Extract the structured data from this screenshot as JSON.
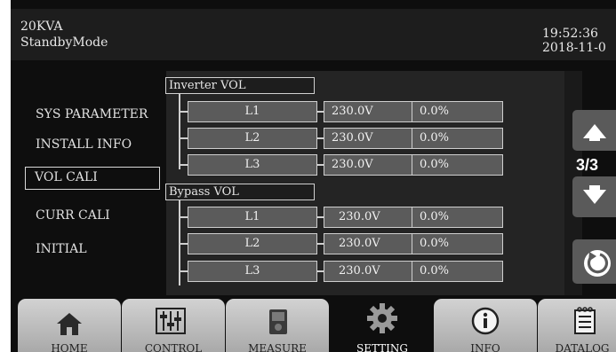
{
  "header": {
    "model": "20KVA",
    "mode": "StandbyMode",
    "time": "19:52:36",
    "date": "2018-11-0"
  },
  "menu": {
    "items": [
      {
        "label": "SYS PARAMETER"
      },
      {
        "label": "INSTALL INFO"
      },
      {
        "label": "VOL CALI"
      },
      {
        "label": "CURR CALI"
      },
      {
        "label": "INITIAL"
      }
    ],
    "active": "VOL CALI"
  },
  "inverter": {
    "title": "Inverter VOL",
    "rows": [
      {
        "phase": "L1",
        "voltage": "230.0V",
        "percent": "0.0%"
      },
      {
        "phase": "L2",
        "voltage": "230.0V",
        "percent": "0.0%"
      },
      {
        "phase": "L3",
        "voltage": "230.0V",
        "percent": "0.0%"
      }
    ]
  },
  "bypass": {
    "title": "Bypass VOL",
    "rows": [
      {
        "phase": "L1",
        "voltage": "230.0V",
        "percent": "0.0%"
      },
      {
        "phase": "L2",
        "voltage": "230.0V",
        "percent": "0.0%"
      },
      {
        "phase": "L3",
        "voltage": "230.0V",
        "percent": "0.0%"
      }
    ]
  },
  "pager": {
    "indicator": "3/3"
  },
  "tabs": [
    {
      "label": "HOME",
      "icon": "home-icon"
    },
    {
      "label": "CONTROL",
      "icon": "control-icon"
    },
    {
      "label": "MEASURE",
      "icon": "measure-icon"
    },
    {
      "label": "SETTING",
      "icon": "gear-icon"
    },
    {
      "label": "INFO",
      "icon": "info-icon"
    },
    {
      "label": "DATALOG",
      "icon": "datalog-icon"
    }
  ],
  "active_tab": "SETTING"
}
